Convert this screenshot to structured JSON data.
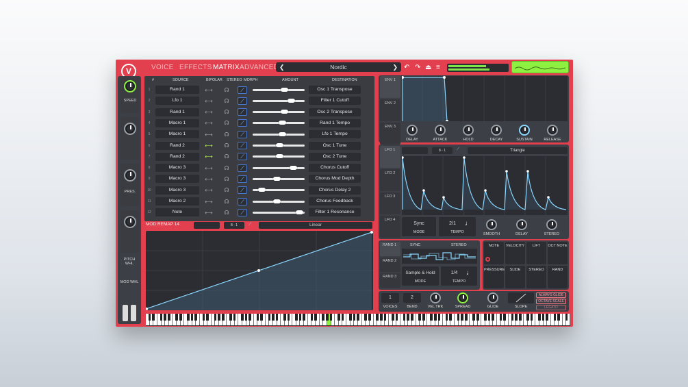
{
  "header": {
    "tabs": [
      "VOICE",
      "EFFECTS",
      "MATRIX",
      "ADVANCED"
    ],
    "active_tab": "MATRIX",
    "preset": "Nordic"
  },
  "sidebar": {
    "speed": "SPEED",
    "pres": "PRES.",
    "pitch": "PITCH WHL",
    "mod": "MOD WHL"
  },
  "matrix": {
    "headers": {
      "num": "#",
      "source": "SOURCE",
      "bipolar": "BIPOLAR",
      "stereo": "STEREO",
      "morph": "MORPH",
      "amount": "AMOUNT",
      "destination": "DESTINATION"
    },
    "rows": [
      {
        "n": "1",
        "source": "Rand 1",
        "destination": "Osc 1 Transpose",
        "amount": 0.62,
        "bipolar_on": false
      },
      {
        "n": "2",
        "source": "Lfo 1",
        "destination": "Filter 1 Cutoff",
        "amount": 0.78,
        "bipolar_on": false
      },
      {
        "n": "3",
        "source": "Rand 1",
        "destination": "Osc 2 Transpose",
        "amount": 0.62,
        "bipolar_on": false
      },
      {
        "n": "4",
        "source": "Macro 1",
        "destination": "Rand 1 Tempo",
        "amount": 0.58,
        "bipolar_on": false
      },
      {
        "n": "5",
        "source": "Macro 1",
        "destination": "Lfo 1 Tempo",
        "amount": 0.58,
        "bipolar_on": false
      },
      {
        "n": "6",
        "source": "Rand 2",
        "destination": "Osc 1 Tune",
        "amount": 0.52,
        "bipolar_on": true
      },
      {
        "n": "7",
        "source": "Rand 2",
        "destination": "Osc 2 Tune",
        "amount": 0.52,
        "bipolar_on": true
      },
      {
        "n": "8",
        "source": "Macro 3",
        "destination": "Chorus Cutoff",
        "amount": 0.82,
        "bipolar_on": false
      },
      {
        "n": "9",
        "source": "Macro 3",
        "destination": "Chorus Mod Depth",
        "amount": 0.45,
        "bipolar_on": false
      },
      {
        "n": "10",
        "source": "Macro 3",
        "destination": "Chorus Delay 2",
        "amount": 0.12,
        "bipolar_on": false
      },
      {
        "n": "11",
        "source": "Macro 2",
        "destination": "Chorus Feedback",
        "amount": 0.46,
        "bipolar_on": false
      },
      {
        "n": "12",
        "source": "Note",
        "destination": "Filter 1 Resonance",
        "amount": 0.95,
        "bipolar_on": false
      }
    ]
  },
  "remap": {
    "title": "MOD REMAP 14",
    "count_a": "8",
    "count_b": "1",
    "curve": "Linear"
  },
  "env": {
    "labels": [
      "ENV 1",
      "ENV 2",
      "ENV 3"
    ],
    "knobs": [
      "DELAY",
      "ATTACK",
      "HOLD",
      "DECAY",
      "SUSTAIN",
      "RELEASE"
    ]
  },
  "lfo": {
    "labels": [
      "LFO 1",
      "LFO 2",
      "LFO 3",
      "LFO 4"
    ],
    "count_a": "8",
    "count_b": "1",
    "shape": "Triangle",
    "mode_value": "Sync",
    "mode_label": "MODE",
    "tempo_value": "2/1",
    "tempo_label": "TEMPO",
    "knobs": [
      "SMOOTH",
      "DELAY",
      "STEREO"
    ]
  },
  "rand": {
    "labels": [
      "RAND 1",
      "RAND 2",
      "RAND 3"
    ],
    "sync": "SYNC",
    "stereo": "STEREO",
    "mode_value": "Sample & Hold",
    "mode_label": "MODE",
    "tempo_value": "1/4",
    "tempo_label": "TEMPO"
  },
  "mods": {
    "row1": [
      "NOTE",
      "VELOCITY",
      "LIFT",
      "OCT NOTE"
    ],
    "row2": [
      "PRESSURE",
      "SLIDE",
      "STEREO",
      "RAND"
    ]
  },
  "voice": {
    "voices_value": "1",
    "voices_label": "VOICES",
    "bend_value": "2",
    "bend_label": "BEND",
    "vel_label": "VEL TRK",
    "spread_label": "SPREAD",
    "glide_label": "GLIDE",
    "slope_label": "SLOPE",
    "btn1": "ALWAYS GLIDE",
    "btn2": "OCTAVE SCALE",
    "btn3": "LEGATO"
  },
  "colors": {
    "accent": "#e2404e",
    "active_green": "#8ef040",
    "mod_blue": "#8ad8ff"
  }
}
